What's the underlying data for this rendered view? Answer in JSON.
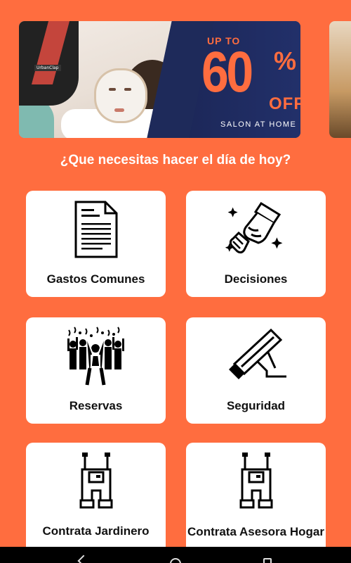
{
  "banner": {
    "promo_top": "UP TO",
    "promo_number": "60",
    "promo_percent": "%",
    "promo_off": "OFF",
    "promo_subtitle": "SALON AT HOME",
    "photo_tag": "UrbanClap",
    "promo_color": "#ff6d3f",
    "background_color": "#1e2a5a"
  },
  "question": "¿Que necesitas hacer el día de hoy?",
  "cards": [
    {
      "label": "Gastos Comunes",
      "icon": "document-icon"
    },
    {
      "label": "Decisiones",
      "icon": "handshake-icon"
    },
    {
      "label": "Reservas",
      "icon": "crowd-party-icon"
    },
    {
      "label": "Seguridad",
      "icon": "security-camera-icon"
    },
    {
      "label": "Contrata Jardinero",
      "icon": "overalls-icon"
    },
    {
      "label": "Contrata Asesora Hogar",
      "icon": "overalls-icon"
    }
  ],
  "colors": {
    "accent": "#ff6d3f",
    "card_bg": "#ffffff",
    "text_dark": "#111111"
  },
  "navbar": {
    "back": "back-icon",
    "home": "home-icon",
    "recent": "recent-apps-icon"
  }
}
